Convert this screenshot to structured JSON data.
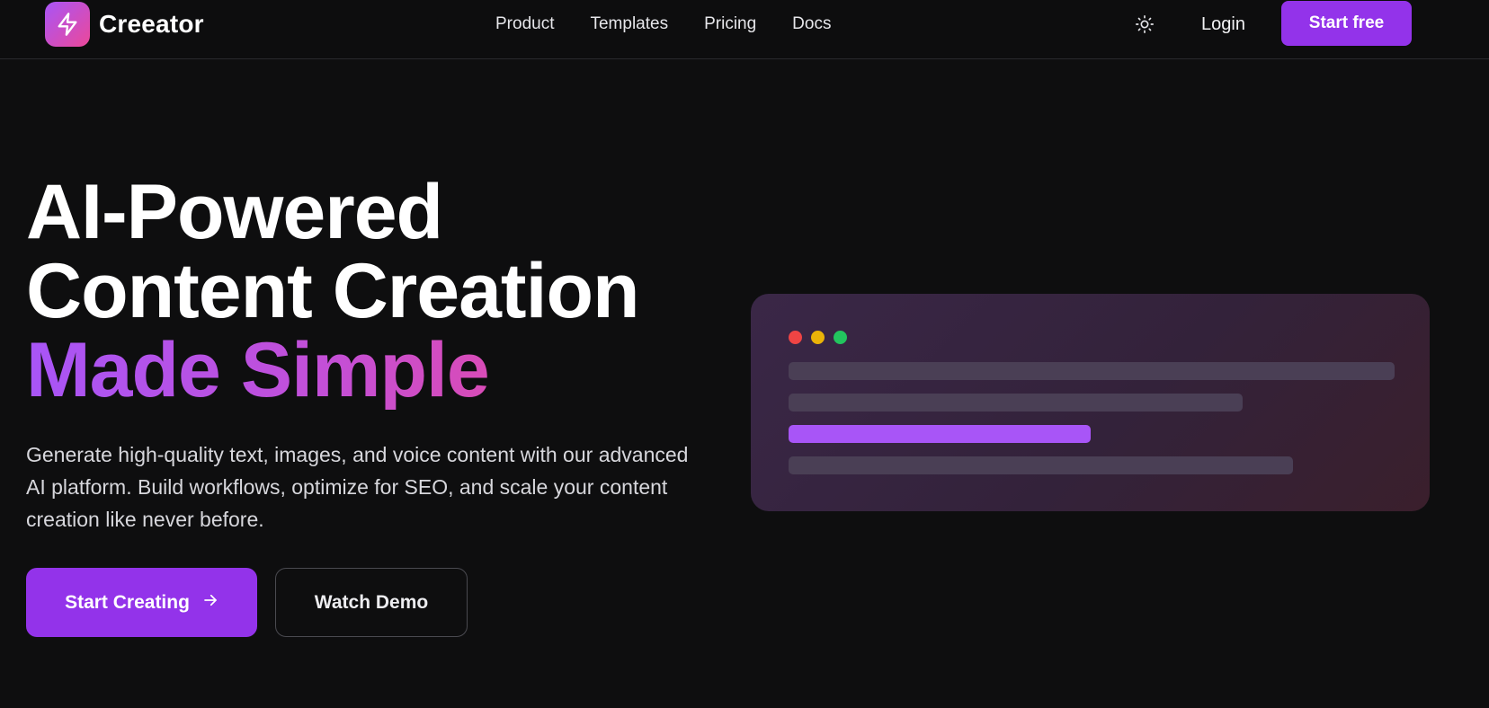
{
  "brand": {
    "name": "Creeator",
    "accent": "#9333ea",
    "gradient_start": "#a855f7",
    "gradient_end": "#ec4899"
  },
  "nav": {
    "items": [
      {
        "label": "Product"
      },
      {
        "label": "Templates"
      },
      {
        "label": "Pricing"
      },
      {
        "label": "Docs"
      }
    ],
    "theme_icon": "sun-icon",
    "login": "Login",
    "cta": "Start free"
  },
  "hero": {
    "title_line1": "AI-Powered",
    "title_line2": "Content Creation",
    "title_line3": "Made Simple",
    "description": "Generate high-quality text, images, and voice content with our advanced AI platform. Build workflows, optimize for SEO, and scale your content creation like never before.",
    "primary_button": "Start Creating",
    "primary_icon": "arrow-right-icon",
    "secondary_button": "Watch Demo"
  },
  "preview": {
    "window_dots": [
      "#ef4444",
      "#eab308",
      "#22c55e"
    ],
    "highlight_color": "#a855f7"
  }
}
